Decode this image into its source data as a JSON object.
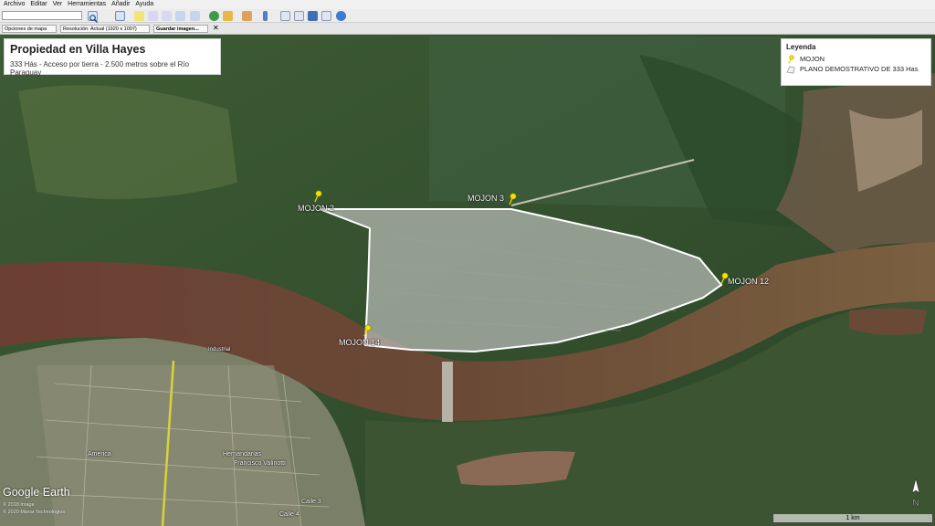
{
  "menu": [
    "Archivo",
    "Editar",
    "Ver",
    "Herramientas",
    "Añadir",
    "Ayuda"
  ],
  "options": {
    "map_options": "Opciones de mapa",
    "resolution": "Resolución: Actual (1920 x 1007)",
    "save_image": "Guardar imagen...",
    "close": "✕"
  },
  "title": {
    "heading": "Propiedad en Villa Hayes",
    "subtitle": "333 Hás - Acceso por tierra - 2.500 metros sobre el Río Paraguay"
  },
  "legend": {
    "title": "Leyenda",
    "items": [
      {
        "label": "MOJON"
      },
      {
        "label": "PLANO DEMOSTRATIVO DE 333 Has"
      }
    ]
  },
  "markers": [
    "MOJON 2",
    "MOJON 3",
    "MOJON 12",
    "MOJON 14"
  ],
  "map_labels": [
    "Industrial",
    "America",
    "Hernandarias",
    "Francisco Valinotti",
    "Calle 3",
    "Calle 4"
  ],
  "logo": "Google Earth",
  "copyright": [
    "© 2018 Image",
    "© 2020 Maxar Technologies"
  ],
  "scale": "1 km",
  "north": "N",
  "colors": {
    "polygon_outline": "#ffffff",
    "pin": "#f2e300",
    "river": "#6a4a36"
  }
}
